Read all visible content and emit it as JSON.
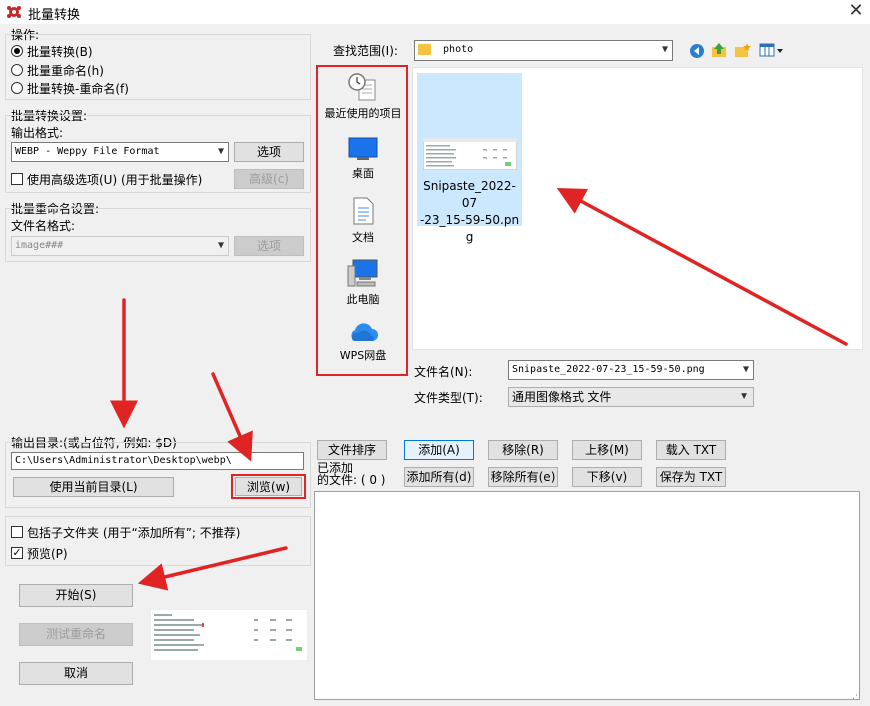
{
  "window": {
    "title": "批量转换",
    "close": "✕"
  },
  "operation": {
    "label": "操作:",
    "options": [
      "批量转换(B)",
      "批量重命名(h)",
      "批量转换-重命名(f)"
    ],
    "selected_index": 0
  },
  "convert_settings": {
    "label": "批量转换设置:",
    "output_format_label": "输出格式:",
    "output_format_value": "WEBP - Weppy File Format",
    "options_button": "选项",
    "advanced_checkbox": "使用高级选项(U) (用于批量操作)",
    "advanced_checked": false,
    "advanced_button": "高级(c)"
  },
  "rename_settings": {
    "label": "批量重命名设置:",
    "filename_format_label": "文件名格式:",
    "filename_format_value": "image###",
    "options_button": "选项"
  },
  "output_dir": {
    "label": "输出目录:(或占位符, 例如: $D)",
    "value": "C:\\Users\\Administrator\\Desktop\\webp\\",
    "use_current_button": "使用当前目录(L)",
    "browse_button": "浏览(w)"
  },
  "extras": {
    "include_subfolders": "包括子文件夹 (用于“添加所有”; 不推荐)",
    "include_subfolders_checked": false,
    "preview": "预览(P)",
    "preview_checked": true
  },
  "actions": {
    "start_button": "开始(S)",
    "test_rename_button": "测试重命名",
    "cancel_button": "取消"
  },
  "browser": {
    "look_in_label": "查找范围(I):",
    "look_in_value": "photo",
    "places": [
      "最近使用的项目",
      "桌面",
      "文档",
      "此电脑",
      "WPS网盘"
    ],
    "files": [
      {
        "name": "Snipaste_2022-07-23_15-59-50.png",
        "name_lines": [
          "Snipaste_2022-07",
          "-23_15-59-50.pn",
          "g"
        ]
      }
    ],
    "filename_label": "文件名(N):",
    "filename_value": "Snipaste_2022-07-23_15-59-50.png",
    "filetype_label": "文件类型(T):",
    "filetype_value": "通用图像格式 文件"
  },
  "queue": {
    "buttons_row1": [
      "文件排序",
      "添加(A)",
      "移除(R)",
      "上移(M)",
      "载入 TXT"
    ],
    "buttons_row2": [
      "添加所有(d)",
      "移除所有(e)",
      "下移(v)",
      "保存为 TXT"
    ],
    "added_label_line1": "已添加",
    "added_label_line2": "的文件: ( 0 )"
  },
  "colors": {
    "accent_red": "#e02424",
    "selection_blue": "#cce8ff",
    "focus_blue": "#0078d7"
  }
}
